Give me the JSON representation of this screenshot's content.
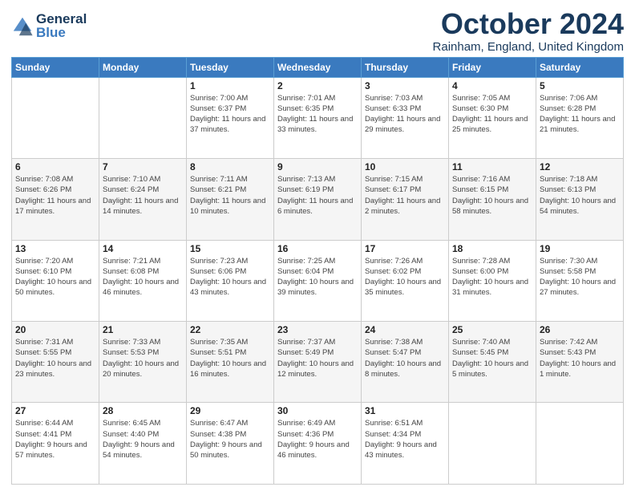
{
  "logo": {
    "line1": "General",
    "line2": "Blue"
  },
  "title": "October 2024",
  "location": "Rainham, England, United Kingdom",
  "days_of_week": [
    "Sunday",
    "Monday",
    "Tuesday",
    "Wednesday",
    "Thursday",
    "Friday",
    "Saturday"
  ],
  "weeks": [
    [
      null,
      null,
      {
        "day": "1",
        "sunrise": "Sunrise: 7:00 AM",
        "sunset": "Sunset: 6:37 PM",
        "daylight": "Daylight: 11 hours and 37 minutes."
      },
      {
        "day": "2",
        "sunrise": "Sunrise: 7:01 AM",
        "sunset": "Sunset: 6:35 PM",
        "daylight": "Daylight: 11 hours and 33 minutes."
      },
      {
        "day": "3",
        "sunrise": "Sunrise: 7:03 AM",
        "sunset": "Sunset: 6:33 PM",
        "daylight": "Daylight: 11 hours and 29 minutes."
      },
      {
        "day": "4",
        "sunrise": "Sunrise: 7:05 AM",
        "sunset": "Sunset: 6:30 PM",
        "daylight": "Daylight: 11 hours and 25 minutes."
      },
      {
        "day": "5",
        "sunrise": "Sunrise: 7:06 AM",
        "sunset": "Sunset: 6:28 PM",
        "daylight": "Daylight: 11 hours and 21 minutes."
      }
    ],
    [
      {
        "day": "6",
        "sunrise": "Sunrise: 7:08 AM",
        "sunset": "Sunset: 6:26 PM",
        "daylight": "Daylight: 11 hours and 17 minutes."
      },
      {
        "day": "7",
        "sunrise": "Sunrise: 7:10 AM",
        "sunset": "Sunset: 6:24 PM",
        "daylight": "Daylight: 11 hours and 14 minutes."
      },
      {
        "day": "8",
        "sunrise": "Sunrise: 7:11 AM",
        "sunset": "Sunset: 6:21 PM",
        "daylight": "Daylight: 11 hours and 10 minutes."
      },
      {
        "day": "9",
        "sunrise": "Sunrise: 7:13 AM",
        "sunset": "Sunset: 6:19 PM",
        "daylight": "Daylight: 11 hours and 6 minutes."
      },
      {
        "day": "10",
        "sunrise": "Sunrise: 7:15 AM",
        "sunset": "Sunset: 6:17 PM",
        "daylight": "Daylight: 11 hours and 2 minutes."
      },
      {
        "day": "11",
        "sunrise": "Sunrise: 7:16 AM",
        "sunset": "Sunset: 6:15 PM",
        "daylight": "Daylight: 10 hours and 58 minutes."
      },
      {
        "day": "12",
        "sunrise": "Sunrise: 7:18 AM",
        "sunset": "Sunset: 6:13 PM",
        "daylight": "Daylight: 10 hours and 54 minutes."
      }
    ],
    [
      {
        "day": "13",
        "sunrise": "Sunrise: 7:20 AM",
        "sunset": "Sunset: 6:10 PM",
        "daylight": "Daylight: 10 hours and 50 minutes."
      },
      {
        "day": "14",
        "sunrise": "Sunrise: 7:21 AM",
        "sunset": "Sunset: 6:08 PM",
        "daylight": "Daylight: 10 hours and 46 minutes."
      },
      {
        "day": "15",
        "sunrise": "Sunrise: 7:23 AM",
        "sunset": "Sunset: 6:06 PM",
        "daylight": "Daylight: 10 hours and 43 minutes."
      },
      {
        "day": "16",
        "sunrise": "Sunrise: 7:25 AM",
        "sunset": "Sunset: 6:04 PM",
        "daylight": "Daylight: 10 hours and 39 minutes."
      },
      {
        "day": "17",
        "sunrise": "Sunrise: 7:26 AM",
        "sunset": "Sunset: 6:02 PM",
        "daylight": "Daylight: 10 hours and 35 minutes."
      },
      {
        "day": "18",
        "sunrise": "Sunrise: 7:28 AM",
        "sunset": "Sunset: 6:00 PM",
        "daylight": "Daylight: 10 hours and 31 minutes."
      },
      {
        "day": "19",
        "sunrise": "Sunrise: 7:30 AM",
        "sunset": "Sunset: 5:58 PM",
        "daylight": "Daylight: 10 hours and 27 minutes."
      }
    ],
    [
      {
        "day": "20",
        "sunrise": "Sunrise: 7:31 AM",
        "sunset": "Sunset: 5:55 PM",
        "daylight": "Daylight: 10 hours and 23 minutes."
      },
      {
        "day": "21",
        "sunrise": "Sunrise: 7:33 AM",
        "sunset": "Sunset: 5:53 PM",
        "daylight": "Daylight: 10 hours and 20 minutes."
      },
      {
        "day": "22",
        "sunrise": "Sunrise: 7:35 AM",
        "sunset": "Sunset: 5:51 PM",
        "daylight": "Daylight: 10 hours and 16 minutes."
      },
      {
        "day": "23",
        "sunrise": "Sunrise: 7:37 AM",
        "sunset": "Sunset: 5:49 PM",
        "daylight": "Daylight: 10 hours and 12 minutes."
      },
      {
        "day": "24",
        "sunrise": "Sunrise: 7:38 AM",
        "sunset": "Sunset: 5:47 PM",
        "daylight": "Daylight: 10 hours and 8 minutes."
      },
      {
        "day": "25",
        "sunrise": "Sunrise: 7:40 AM",
        "sunset": "Sunset: 5:45 PM",
        "daylight": "Daylight: 10 hours and 5 minutes."
      },
      {
        "day": "26",
        "sunrise": "Sunrise: 7:42 AM",
        "sunset": "Sunset: 5:43 PM",
        "daylight": "Daylight: 10 hours and 1 minute."
      }
    ],
    [
      {
        "day": "27",
        "sunrise": "Sunrise: 6:44 AM",
        "sunset": "Sunset: 4:41 PM",
        "daylight": "Daylight: 9 hours and 57 minutes."
      },
      {
        "day": "28",
        "sunrise": "Sunrise: 6:45 AM",
        "sunset": "Sunset: 4:40 PM",
        "daylight": "Daylight: 9 hours and 54 minutes."
      },
      {
        "day": "29",
        "sunrise": "Sunrise: 6:47 AM",
        "sunset": "Sunset: 4:38 PM",
        "daylight": "Daylight: 9 hours and 50 minutes."
      },
      {
        "day": "30",
        "sunrise": "Sunrise: 6:49 AM",
        "sunset": "Sunset: 4:36 PM",
        "daylight": "Daylight: 9 hours and 46 minutes."
      },
      {
        "day": "31",
        "sunrise": "Sunrise: 6:51 AM",
        "sunset": "Sunset: 4:34 PM",
        "daylight": "Daylight: 9 hours and 43 minutes."
      },
      null,
      null
    ]
  ]
}
